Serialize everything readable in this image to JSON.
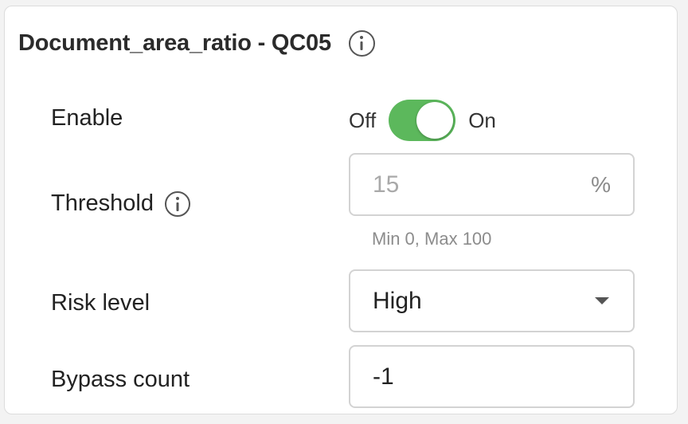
{
  "panel": {
    "title": "Document_area_ratio - QC05",
    "title_info_icon": "info-icon"
  },
  "enable": {
    "label": "Enable",
    "off_label": "Off",
    "on_label": "On",
    "state": "on",
    "accent_color": "#5cb85c"
  },
  "threshold": {
    "label": "Threshold",
    "info_icon": "info-icon",
    "value": "15",
    "unit": "%",
    "hint": "Min 0, Max 100"
  },
  "risk_level": {
    "label": "Risk level",
    "selected": "High"
  },
  "bypass_count": {
    "label": "Bypass count",
    "value": "-1"
  }
}
